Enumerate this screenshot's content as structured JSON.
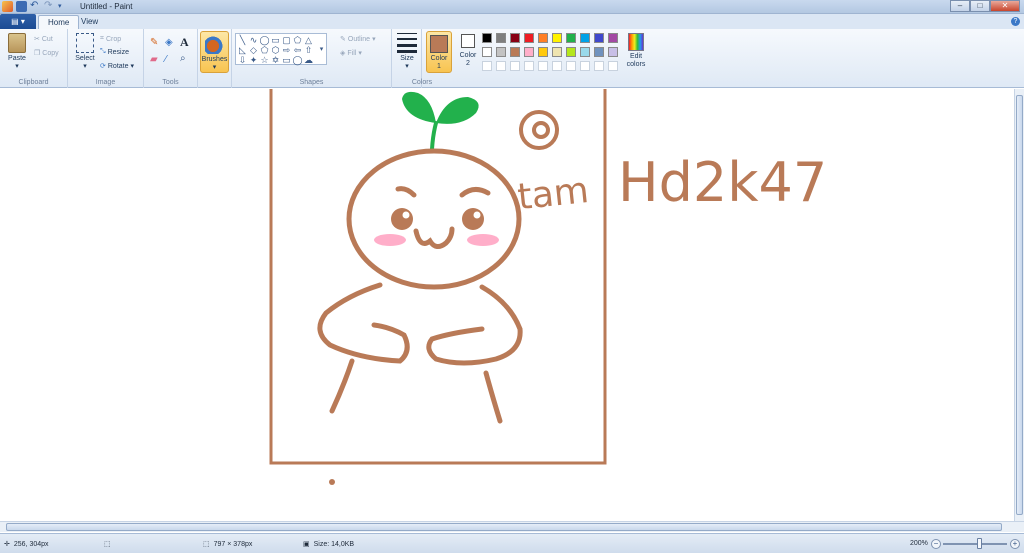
{
  "window": {
    "title": "Untitled - Paint"
  },
  "tabs": {
    "file_label": "▤ ▾",
    "home": "Home",
    "view": "View",
    "help": "?"
  },
  "ribbon": {
    "clipboard": {
      "group_label": "Clipboard",
      "paste": "Paste",
      "cut": "Cut",
      "copy": "Copy"
    },
    "image": {
      "group_label": "Image",
      "select": "Select",
      "crop": "Crop",
      "resize": "Resize",
      "rotate": "Rotate"
    },
    "tools": {
      "group_label": "Tools",
      "text_tool": "A"
    },
    "brushes": {
      "label": "Brushes"
    },
    "shapes": {
      "group_label": "Shapes",
      "outline": "Outline",
      "fill": "Fill"
    },
    "size": {
      "label": "Size"
    },
    "colors": {
      "group_label": "Colors",
      "color1_label": "Color 1",
      "color2_label": "Color 2",
      "color1_value": "#b97a57",
      "color2_value": "#ffffff",
      "edit_colors": "Edit colors",
      "palette_row1": [
        "#000000",
        "#7f7f7f",
        "#880015",
        "#ed1c24",
        "#ff7f27",
        "#fff200",
        "#22b14c",
        "#00a2e8",
        "#3f48cc",
        "#a349a4"
      ],
      "palette_row2": [
        "#ffffff",
        "#c3c3c3",
        "#b97a57",
        "#ffaec9",
        "#ffc90e",
        "#efe4b0",
        "#b5e61d",
        "#99d9ea",
        "#7092be",
        "#c8bfe7"
      ]
    }
  },
  "status": {
    "cursor_pos": "256, 304px",
    "selection_size": "",
    "canvas_size": "797 × 378px",
    "file_size": "Size: 14,0KB",
    "zoom": "200%"
  },
  "drawing": {
    "handwriting_tam": "tam",
    "handwriting_code": "Hd2k47",
    "sprout_color": "#22b14c",
    "stroke_color": "#b97a57",
    "blush_color": "#ffaec9"
  }
}
